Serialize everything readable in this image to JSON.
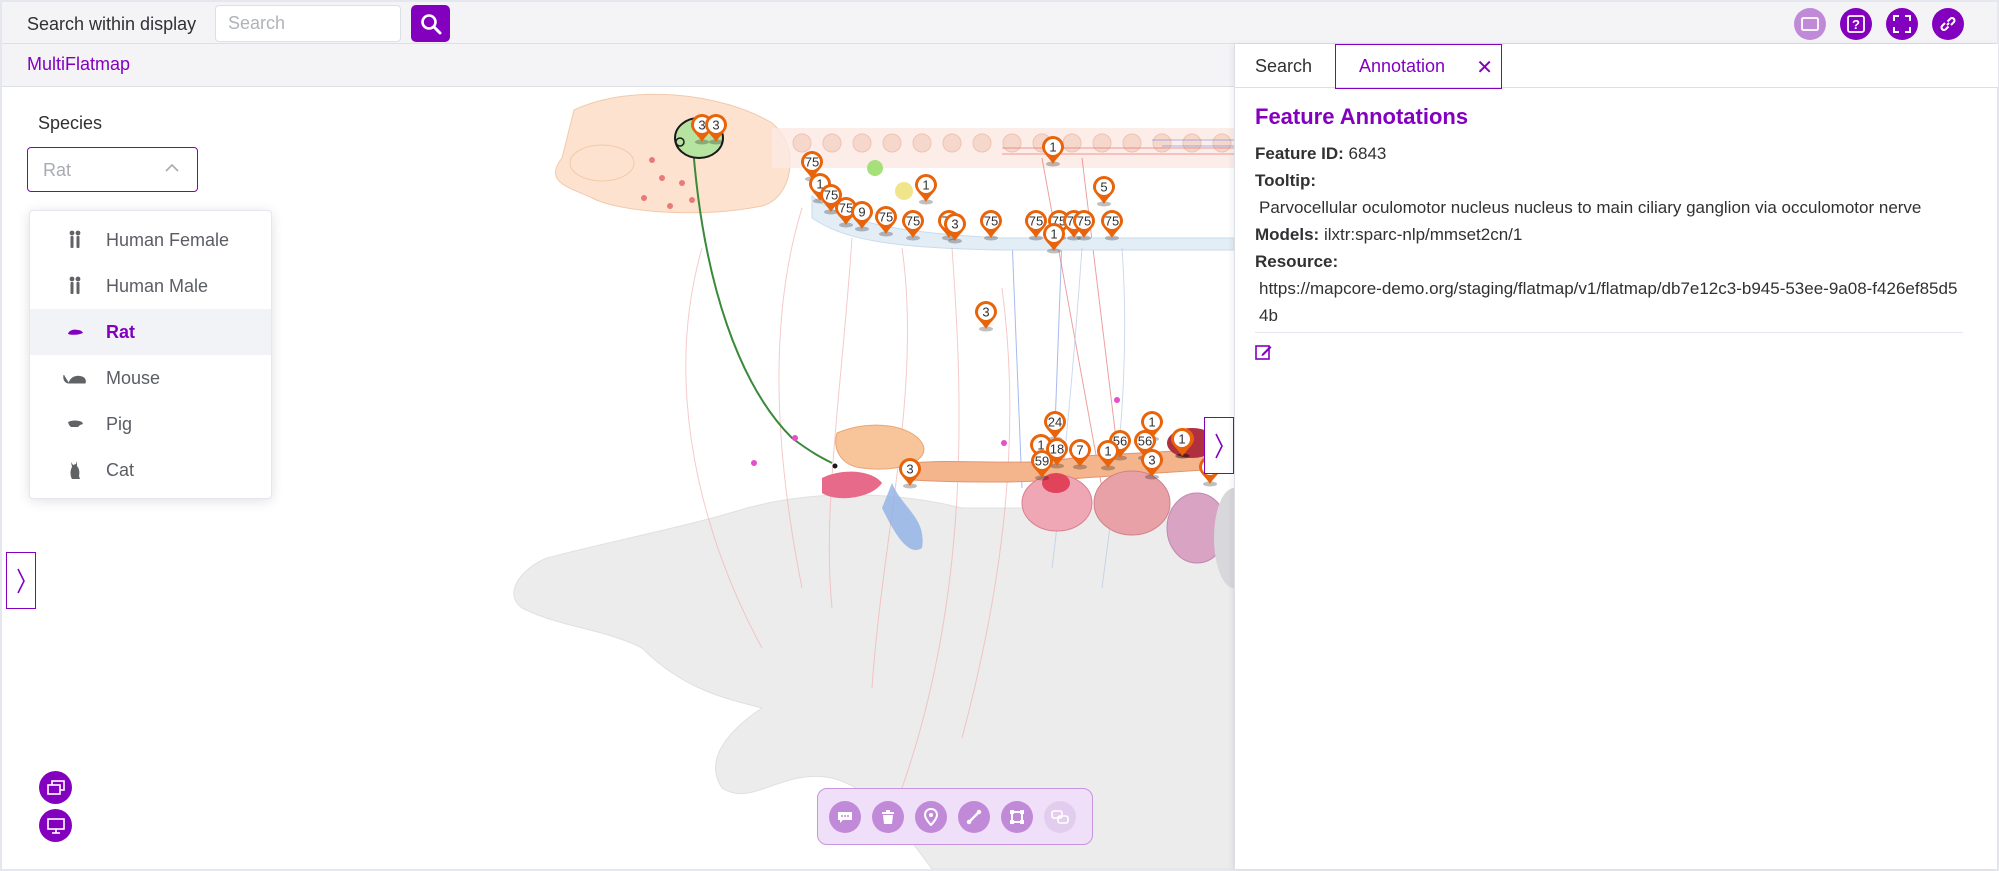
{
  "topbar": {
    "search_label": "Search within display",
    "search_placeholder": "Search",
    "icons": [
      "screen-icon",
      "help-icon",
      "fullscreen-icon",
      "link-icon"
    ]
  },
  "app": {
    "title": "MultiFlatmap"
  },
  "species": {
    "label": "Species",
    "selected": "Rat",
    "options": [
      {
        "label": "Human Female",
        "icon": "human-female-icon"
      },
      {
        "label": "Human Male",
        "icon": "human-male-icon"
      },
      {
        "label": "Rat",
        "icon": "rat-icon"
      },
      {
        "label": "Mouse",
        "icon": "mouse-icon"
      },
      {
        "label": "Pig",
        "icon": "pig-icon"
      },
      {
        "label": "Cat",
        "icon": "cat-icon"
      }
    ]
  },
  "toolbar": {
    "tools": [
      "comment-tool",
      "delete-tool",
      "point-tool",
      "line-tool",
      "polygon-tool",
      "connection-tool"
    ]
  },
  "map_pins": [
    "3",
    "3",
    "75",
    "1",
    "1",
    "75",
    "1",
    "75",
    "9",
    "75",
    "75",
    "75",
    "3",
    "75",
    "75",
    "75",
    "75",
    "75",
    "75",
    "1",
    "5",
    "3",
    "24",
    "1",
    "1",
    "1",
    "18",
    "56",
    "56",
    "7",
    "1",
    "59",
    "3",
    "1",
    "3",
    "2"
  ],
  "panel": {
    "tabs": {
      "search": "Search",
      "annotation": "Annotation"
    },
    "title": "Feature Annotations",
    "feature_id_label": "Feature ID:",
    "feature_id": "6843",
    "tooltip_label": "Tooltip:",
    "tooltip": "Parvocellular oculomotor nucleus nucleus to main ciliary ganglion via occulomotor nerve",
    "models_label": "Models:",
    "models": "ilxtr:sparc-nlp/mmset2cn/1",
    "resource_label": "Resource:",
    "resource": "https://mapcore-demo.org/staging/flatmap/v1/flatmap/db7e12c3-b945-53ee-9a08-f426ef85d54b"
  },
  "colors": {
    "accent": "#8300bf",
    "pin": "#e8630a"
  }
}
